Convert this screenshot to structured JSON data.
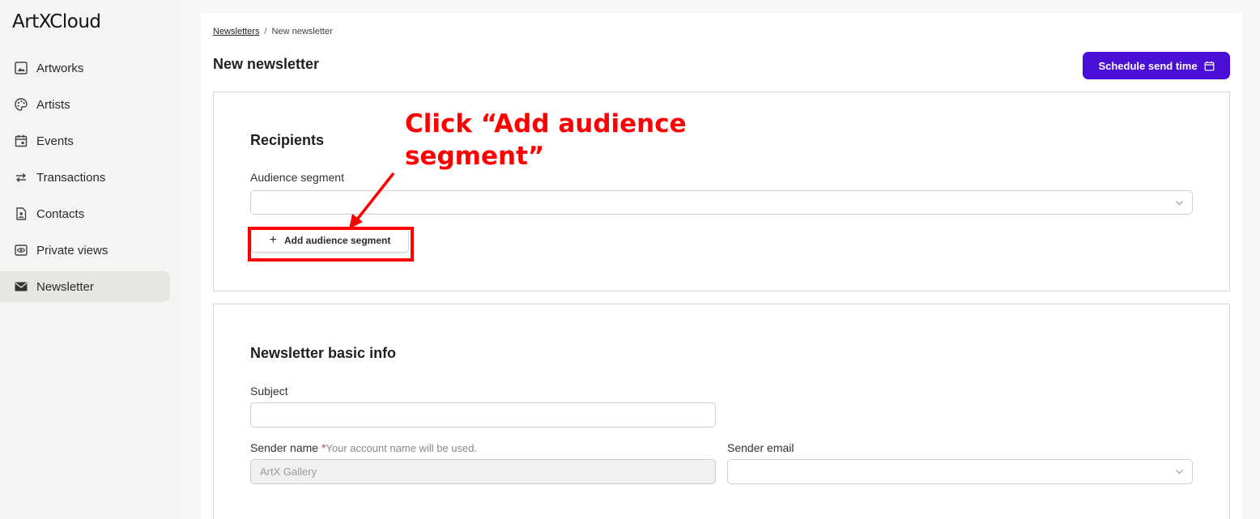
{
  "app": {
    "logo_text": "ArtXCloud"
  },
  "sidebar": {
    "items": [
      {
        "label": "Artworks",
        "icon": "image-icon",
        "active": false
      },
      {
        "label": "Artists",
        "icon": "palette-icon",
        "active": false
      },
      {
        "label": "Events",
        "icon": "calendar-icon",
        "active": false
      },
      {
        "label": "Transactions",
        "icon": "arrows-swap-icon",
        "active": false
      },
      {
        "label": "Contacts",
        "icon": "contact-card-icon",
        "active": false
      },
      {
        "label": "Private views",
        "icon": "eye-icon",
        "active": false
      },
      {
        "label": "Newsletter",
        "icon": "envelope-icon",
        "active": true
      }
    ]
  },
  "breadcrumb": {
    "parent": "Newsletters",
    "separator": "/",
    "current": "New newsletter"
  },
  "header": {
    "title": "New newsletter",
    "schedule_button": "Schedule send time"
  },
  "recipients": {
    "title": "Recipients",
    "audience_label": "Audience segment",
    "audience_value": "",
    "add_segment_button": "Add audience segment"
  },
  "basic_info": {
    "title": "Newsletter basic info",
    "subject_label": "Subject",
    "subject_value": "",
    "sender_name_label": "Sender name",
    "sender_name_required": "*",
    "sender_name_hint": "Your account name will be used.",
    "sender_name_value": "ArtX Gallery",
    "sender_email_label": "Sender email",
    "sender_email_value": ""
  },
  "annotation": {
    "text": "Click “Add audience segment”",
    "color": "#ff0000"
  },
  "colors": {
    "primary": "#4a0fd6",
    "sidebar_bg": "#f4f4f2",
    "active_item_bg": "#e6e6e3",
    "annotation": "#ff0000"
  }
}
